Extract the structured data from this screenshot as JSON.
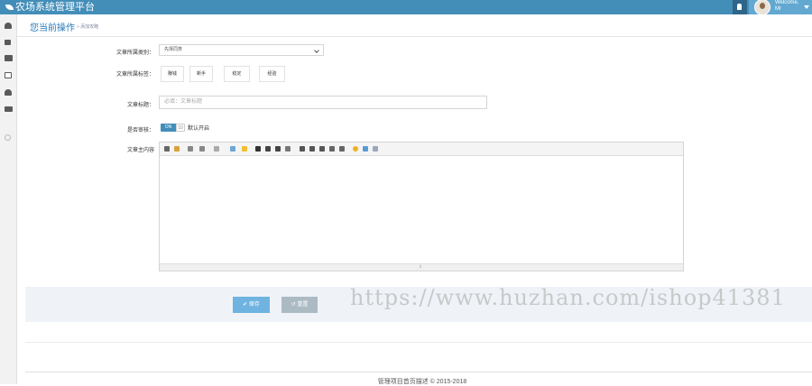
{
  "app": {
    "brand_title": "农场系统管理平台",
    "welcome_label": "Welcome,",
    "user_name": "Mr"
  },
  "breadcrumb": {
    "title": "您当前操作",
    "sub": "» 添加攻略"
  },
  "form": {
    "category_label": "文章所属类别：",
    "category_value": "先择同类",
    "tags_label": "文章所属标签：",
    "tags": [
      "赚钱",
      "新手",
      "稳定",
      "经验"
    ],
    "title_label": "文章标题：",
    "title_placeholder": "必填：文章标题",
    "review_label": "是否审核：",
    "toggle_on": "ON",
    "toggle_off": "10",
    "toggle_note": "默认开启",
    "content_label": "文章主内容"
  },
  "editor": {
    "resize_glyph": "⇓"
  },
  "actions": {
    "save_label": "✔ 保存",
    "reset_label": "↺ 重置"
  },
  "watermark": "https://www.huzhan.com/ishop41381",
  "footer": "管理项目首页描述 © 2015-2018"
}
